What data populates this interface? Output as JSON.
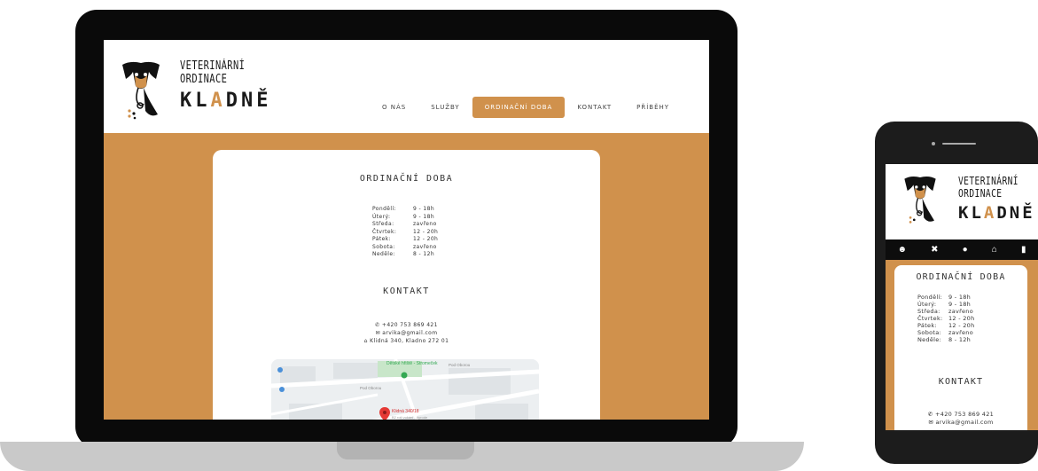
{
  "brand": {
    "line1": "Veterinární",
    "line2": "ordinace",
    "line3_a": "K",
    "line3_b": "L",
    "line3_accent": "A",
    "line3_c": "DNĚ"
  },
  "nav": {
    "items": [
      {
        "label": "O NÁS"
      },
      {
        "label": "SLUŽBY"
      },
      {
        "label": "ORDINAČNÍ DOBA"
      },
      {
        "label": "KONTAKT"
      },
      {
        "label": "PŘÍBĚHY"
      }
    ]
  },
  "hours": {
    "title": "ordinační doba",
    "rows": [
      {
        "day": "Pondělí:",
        "time": "9 - 18h"
      },
      {
        "day": "Úterý:",
        "time": "9 - 18h"
      },
      {
        "day": "Středa:",
        "time": "zavřeno"
      },
      {
        "day": "Čtvrtek:",
        "time": "12 - 20h"
      },
      {
        "day": "Pátek:",
        "time": "12 - 20h"
      },
      {
        "day": "Sobota:",
        "time": "zavřeno"
      },
      {
        "day": "Neděle:",
        "time": "8 - 12h"
      }
    ]
  },
  "contact": {
    "title": "kontakt",
    "phone": "+420 753 869 421",
    "email": "arvika@gmail.com",
    "address": "Klidná 340, Kladno 272 01"
  },
  "map": {
    "labels": {
      "street1": "Pod Oborou",
      "street2": "Pod Oborou",
      "park": "Dětské hřiště - Stromeček",
      "pin": "Klidná 340/18",
      "pin_sub": "B2 roti vokáni - Ayrode"
    }
  },
  "phone_nav_icons": [
    "users-icon",
    "tools-icon",
    "clock-icon",
    "home-icon",
    "book-icon"
  ],
  "colors": {
    "accent": "#d0914c",
    "nav_bg": "#0d0d0d"
  }
}
